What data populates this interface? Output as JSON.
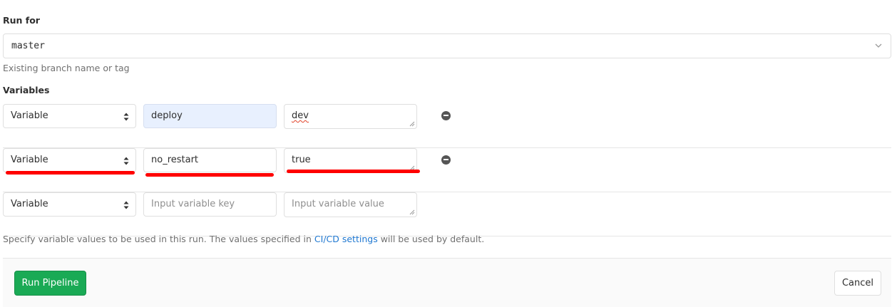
{
  "run_for": {
    "label": "Run for",
    "selected_ref": "master",
    "help": "Existing branch name or tag"
  },
  "variables": {
    "label": "Variables",
    "rows": [
      {
        "type": "Variable",
        "key": "deploy",
        "value": "dev"
      },
      {
        "type": "Variable",
        "key": "no_restart",
        "value": "true"
      },
      {
        "type": "Variable",
        "key_placeholder": "Input variable key",
        "value_placeholder": "Input variable value"
      }
    ],
    "info_prefix": "Specify variable values to be used in this run. The values specified in ",
    "info_link": "CI/CD settings",
    "info_suffix": " will be used by default."
  },
  "footer": {
    "run_label": "Run Pipeline",
    "cancel_label": "Cancel"
  },
  "colors": {
    "primary_button": "#1aaa55",
    "link": "#1f78d1",
    "annotation": "#ff0000",
    "autofill": "#e8f0fe"
  }
}
